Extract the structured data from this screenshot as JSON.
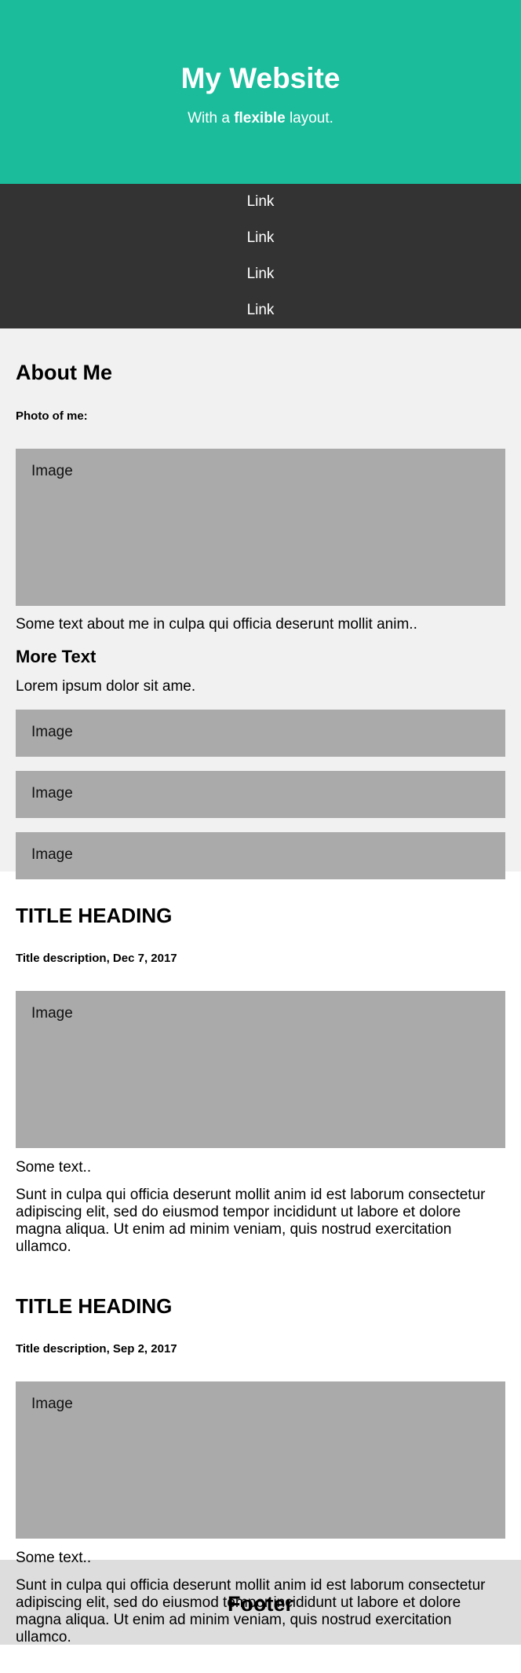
{
  "colors": {
    "header_bg": "#1abc9c",
    "navbar_bg": "#333333",
    "side_bg": "#f1f1f1",
    "image_bg": "#aaaaaa",
    "footer_bg": "#dddddd"
  },
  "header": {
    "title": "My Website",
    "subtitle_prefix": "With a ",
    "subtitle_bold": "flexible",
    "subtitle_suffix": " layout."
  },
  "navbar": {
    "links": [
      "Link",
      "Link",
      "Link",
      "Link"
    ]
  },
  "side": {
    "heading": "About Me",
    "photo_label": "Photo of me:",
    "image_label": "Image",
    "text": "Some text about me in culpa qui officia deserunt mollit anim..",
    "more_heading": "More Text",
    "more_text": "Lorem ipsum dolor sit ame.",
    "small_images": [
      "Image",
      "Image",
      "Image"
    ]
  },
  "main": {
    "articles": [
      {
        "heading": "TITLE HEADING",
        "description": "Title description, Dec 7, 2017",
        "image_label": "Image",
        "short_text": "Some text..",
        "long_text": "Sunt in culpa qui officia deserunt mollit anim id est laborum consectetur adipiscing elit, sed do eiusmod tempor incididunt ut labore et dolore magna aliqua. Ut enim ad minim veniam, quis nostrud exercitation ullamco."
      },
      {
        "heading": "TITLE HEADING",
        "description": "Title description, Sep 2, 2017",
        "image_label": "Image",
        "short_text": "Some text..",
        "long_text": "Sunt in culpa qui officia deserunt mollit anim id est laborum consectetur adipiscing elit, sed do eiusmod tempor incididunt ut labore et dolore magna aliqua. Ut enim ad minim veniam, quis nostrud exercitation ullamco."
      }
    ]
  },
  "footer": {
    "title": "Footer"
  }
}
